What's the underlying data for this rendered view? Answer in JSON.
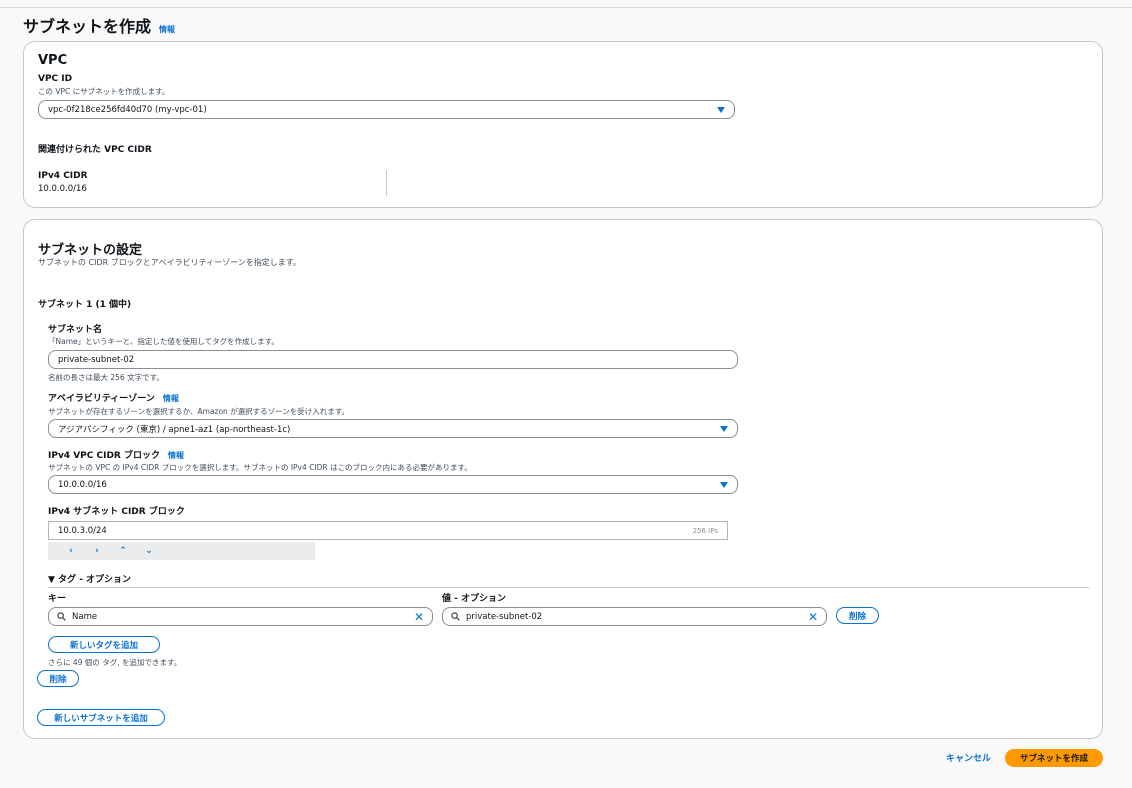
{
  "header": {
    "title": "サブネットを作成",
    "info": "情報"
  },
  "vpc_section": {
    "heading": "VPC",
    "vpc_id_label": "VPC ID",
    "vpc_id_desc": "この VPC にサブネットを作成します。",
    "vpc_id_value": "vpc-0f218ce256fd40d70 (my-vpc-01)",
    "cidr_heading": "関連付けられた VPC CIDR",
    "ipv4_cidr_label": "IPv4 CIDR",
    "ipv4_cidr_value": "10.0.0.0/16"
  },
  "subnet_section": {
    "heading": "サブネットの設定",
    "desc": "サブネットの CIDR ブロックとアベイラビリティーゾーンを指定します。",
    "subnet_count": "サブネット 1 (1 個中)",
    "name_label": "サブネット名",
    "name_desc": "「Name」というキーと、指定した値を使用してタグを作成します。",
    "name_value": "private-subnet-02",
    "name_hint": "名前の長さは最大 256 文字です。",
    "az_label": "アベイラビリティーゾーン",
    "az_info": "情報",
    "az_desc": "サブネットが存在するゾーンを選択するか、Amazon が選択するゾーンを受け入れます。",
    "az_value": "アジアパシフィック (東京) / apne1-az1 (ap-northeast-1c)",
    "vpc_cidr_label": "IPv4 VPC CIDR ブロック",
    "vpc_cidr_info": "情報",
    "vpc_cidr_desc": "サブネットの VPC の IPv4 CIDR ブロックを選択します。サブネットの IPv4 CIDR はこのブロック内にある必要があります。",
    "vpc_cidr_value": "10.0.0.0/16",
    "subnet_cidr_label": "IPv4 サブネット CIDR ブロック",
    "subnet_cidr_value": "10.0.3.0/24",
    "subnet_cidr_ips": "256 IPs",
    "controls": [
      "‹",
      "›",
      "⌃",
      "⌄"
    ],
    "tags_heading": "▼ タグ - オプション",
    "key_header": "キー",
    "value_header": "値 - オプション",
    "tag_key": "Name",
    "tag_value": "private-subnet-02",
    "remove_tag": "削除",
    "add_tag": "新しいタグを追加",
    "tag_hint": "さらに 49 個の タグ, を追加できます。",
    "remove_subnet": "削除",
    "add_subnet": "新しいサブネットを追加"
  },
  "footer": {
    "cancel": "キャンセル",
    "create": "サブネットを作成"
  }
}
